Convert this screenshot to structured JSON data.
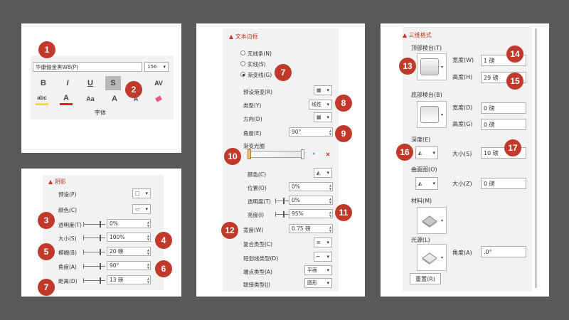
{
  "badges": [
    "1",
    "2",
    "3",
    "4",
    "5",
    "6",
    "7",
    "7",
    "8",
    "9",
    "10",
    "11",
    "12",
    "13",
    "14",
    "15",
    "16",
    "17"
  ],
  "font_panel": {
    "font_name": "华康俪金黑W8(P)",
    "font_size": "156",
    "group_label": "字体",
    "buttons": [
      "B",
      "I",
      "U",
      "S",
      "abc",
      "AV",
      "A",
      "Aa",
      "A",
      "A"
    ]
  },
  "shadow_panel": {
    "title": "阴影",
    "rows": [
      {
        "label": "预设(P)"
      },
      {
        "label": "颜色(C)"
      },
      {
        "label": "透明度(T)",
        "value": "0%"
      },
      {
        "label": "大小(S)",
        "value": "100%"
      },
      {
        "label": "模糊(B)",
        "value": "20 磅"
      },
      {
        "label": "角度(A)",
        "value": "90°"
      },
      {
        "label": "距离(D)",
        "value": "13 磅"
      }
    ]
  },
  "line_panel": {
    "title": "文本边框",
    "radios": [
      "无线条(N)",
      "实线(S)",
      "渐变线(G)"
    ],
    "preset": "预设渐变(R)",
    "type_label": "类型(Y)",
    "type_value": "线性",
    "direction": "方向(D)",
    "angle_label": "角度(E)",
    "angle_value": "90°",
    "stops_label": "渐变光圈",
    "color": "颜色(C)",
    "position_label": "位置(O)",
    "position_value": "0%",
    "transparency_label": "透明度(T)",
    "transparency_value": "0%",
    "brightness_label": "亮度(I)",
    "brightness_value": "95%",
    "width_label": "宽度(W)",
    "width_value": "0.75 磅",
    "compound": "复合类型(C)",
    "dash": "短划线类型(D)",
    "cap_label": "端点类型(A)",
    "cap_value": "平面",
    "join_label": "联接类型(J)",
    "join_value": "圆形"
  },
  "threed_panel": {
    "title": "三维格式",
    "top_bevel": "顶部棱台(T)",
    "width_label": "宽度(W)",
    "top_width": "1 磅",
    "height_label": "高度(H)",
    "top_height": "29 磅",
    "bottom_bevel": "底部棱台(B)",
    "bottom_width_label": "宽度(D)",
    "bottom_width": "0 磅",
    "bottom_height_label": "高度(G)",
    "bottom_height": "0 磅",
    "depth": "深度(E)",
    "size_label": "大小(S)",
    "depth_size": "10 磅",
    "contour": "曲面图(O)",
    "contour_size_label": "大小(Z)",
    "contour_size": "0 磅",
    "material": "材料(M)",
    "lighting": "光源(L)",
    "angle_label": "角度(A)",
    "angle_value": ".0°",
    "reset": "重置(R)"
  },
  "colors": {
    "badge": "#c0392b",
    "background": "#595959",
    "panel": "#f2f2f2"
  }
}
